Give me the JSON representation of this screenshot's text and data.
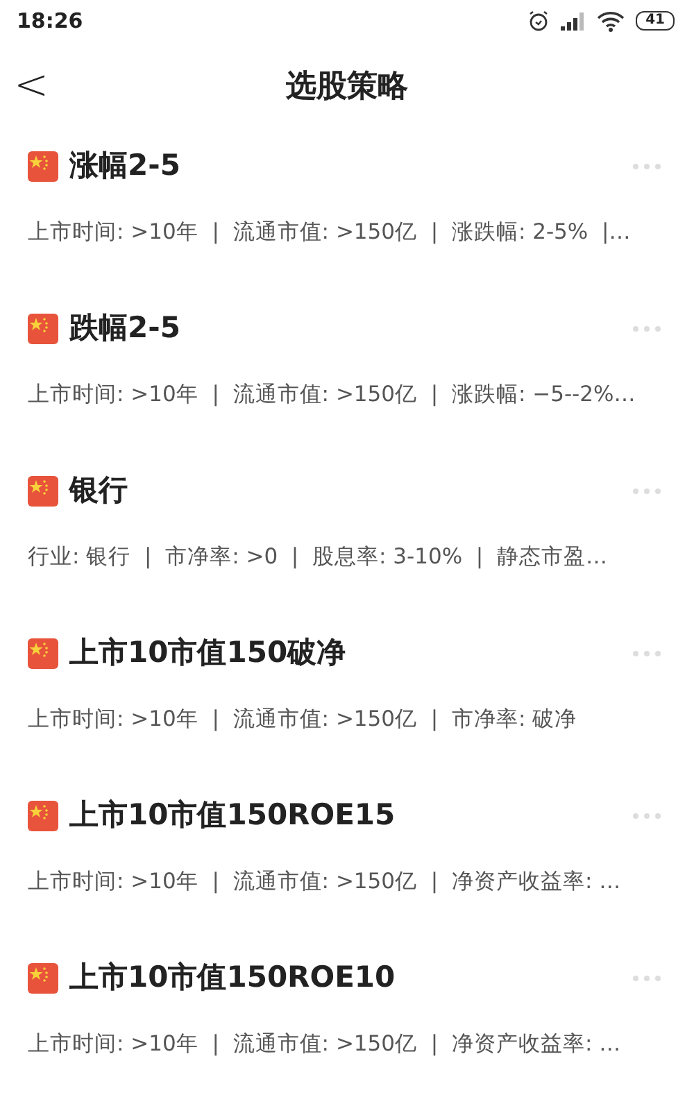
{
  "status_bar": {
    "time": "18:26",
    "battery": "41"
  },
  "header": {
    "back": "<",
    "title": "选股策略"
  },
  "strategies": [
    {
      "name": "涨幅2-5",
      "criteria": "上市时间: >10年  |  流通市值: >150亿  |  涨跌幅: 2-5%  |…"
    },
    {
      "name": "跌幅2-5",
      "criteria": "上市时间: >10年  |  流通市值: >150亿  |  涨跌幅: −5--2%…"
    },
    {
      "name": "银行",
      "criteria": "行业: 银行  |  市净率: >0  |  股息率: 3-10%  |  静态市盈…"
    },
    {
      "name": "上市10市值150破净",
      "criteria": "上市时间: >10年  |  流通市值: >150亿  |  市净率: 破净"
    },
    {
      "name": "上市10市值150ROE15",
      "criteria": "上市时间: >10年  |  流通市值: >150亿  |  净资产收益率: …"
    },
    {
      "name": "上市10市值150ROE10",
      "criteria": "上市时间: >10年  |  流通市值: >150亿  |  净资产收益率: …"
    }
  ]
}
